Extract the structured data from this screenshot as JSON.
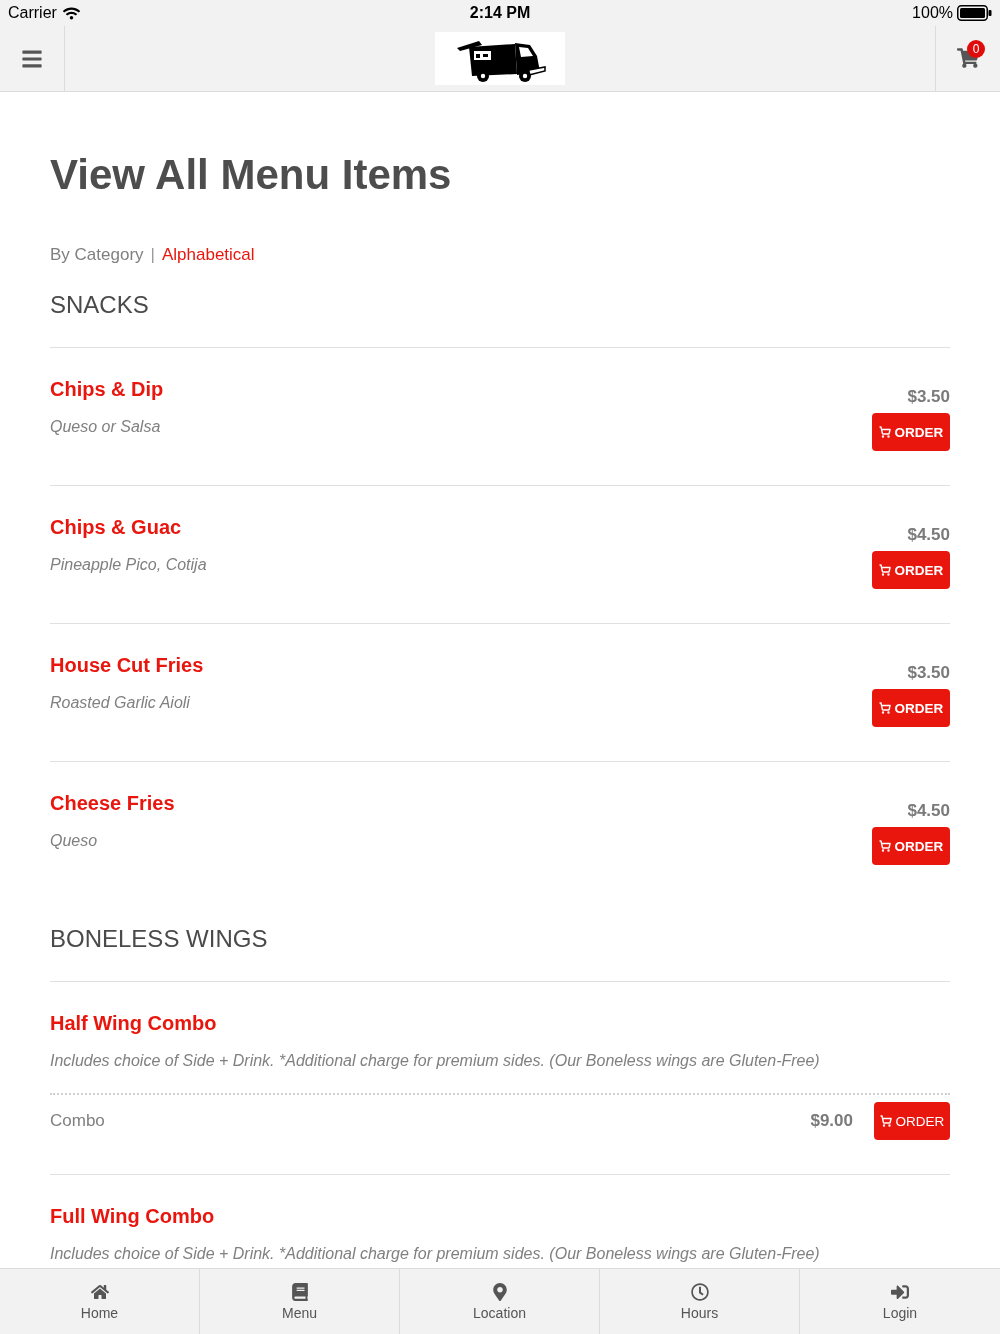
{
  "status_bar": {
    "carrier": "Carrier",
    "time": "2:14 PM",
    "battery": "100%"
  },
  "header": {
    "cart_count": "0"
  },
  "page": {
    "title": "View All Menu Items",
    "view_options": [
      {
        "label": "By Category",
        "selected": true
      },
      {
        "label": "Alphabetical",
        "selected": false
      }
    ],
    "separator": "|"
  },
  "categories": [
    {
      "name": "SNACKS",
      "items": [
        {
          "kind": "simple",
          "name": "Chips & Dip",
          "description": "Queso or Salsa",
          "price": "$3.50",
          "button": "ORDER"
        },
        {
          "kind": "simple",
          "name": "Chips & Guac",
          "description": "Pineapple Pico, Cotija",
          "price": "$4.50",
          "button": "ORDER"
        },
        {
          "kind": "simple",
          "name": "House Cut Fries",
          "description": "Roasted Garlic Aioli",
          "price": "$3.50",
          "button": "ORDER"
        },
        {
          "kind": "simple",
          "name": "Cheese Fries",
          "description": "Queso",
          "price": "$4.50",
          "button": "ORDER"
        }
      ]
    },
    {
      "name": "BONELESS WINGS",
      "items": [
        {
          "kind": "options",
          "name": "Half Wing Combo",
          "description": "Includes choice of Side + Drink. *Additional charge for premium sides. (Our Boneless wings are Gluten-Free)",
          "options": [
            {
              "label": "Combo",
              "price": "$9.00",
              "button": "ORDER"
            }
          ]
        },
        {
          "kind": "options",
          "name": "Full Wing Combo",
          "description": "Includes choice of Side + Drink. *Additional charge for premium sides. (Our Boneless wings are Gluten-Free)"
        }
      ]
    }
  ],
  "tab_bar": [
    {
      "label": "Home"
    },
    {
      "label": "Menu"
    },
    {
      "label": "Location"
    },
    {
      "label": "Hours"
    },
    {
      "label": "Login"
    }
  ]
}
